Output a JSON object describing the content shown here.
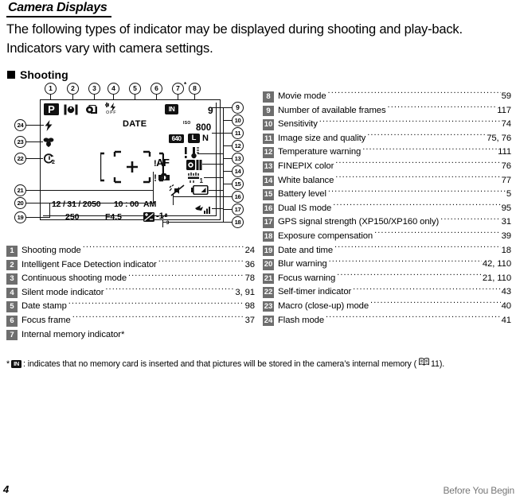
{
  "header": {
    "section_title": "Camera Displays",
    "intro": "The following types of indicator may be displayed during shooting and play-back.  Indicators vary with camera settings.",
    "subsection": "Shooting"
  },
  "figure": {
    "alt": "camera LCD shooting display diagram",
    "lcd": {
      "shooting_mode": "P",
      "face_detection": "face-detection-icon",
      "continuous": "continuous-shooting-icon",
      "silent_mode": "silent-mode-icon",
      "silent_off_label": "OFF",
      "date_stamp": "DATE",
      "internal_memory": "IN",
      "frames_remaining": "9",
      "iso_label": "ISO",
      "iso_value": "800",
      "movie_mode": "640",
      "image_size": "L",
      "image_quality": "N",
      "temperature_warning": "temperature-warning-icon",
      "finepix_color": "finepix-color-icon",
      "white_balance": "white-balance-icon",
      "battery": "battery-icon",
      "dual_is": "dual-is-icon",
      "focus_warning": "AF",
      "blur_warning": "blur-warning-icon",
      "gps": "gps-signal-icon",
      "date": "12 / 31 / 2050",
      "time": "10 : 00",
      "ampm": "AM",
      "shutter_speed": "250",
      "aperture": "F4.5",
      "exposure_comp": "-1",
      "exposure_comp_frac_num": "2",
      "exposure_comp_frac_den": "3"
    },
    "callouts_top": [
      "1",
      "2",
      "3",
      "4",
      "5",
      "6",
      "7",
      "8"
    ],
    "callout7_mark": "*",
    "callouts_right": [
      "9",
      "10",
      "11",
      "12",
      "13",
      "14",
      "15",
      "16",
      "17",
      "18"
    ],
    "callouts_left": [
      "24",
      "23",
      "22",
      "21",
      "20",
      "19"
    ]
  },
  "index_left": [
    {
      "num": "1",
      "label": "Shooting mode",
      "page": "24"
    },
    {
      "num": "2",
      "label": "Intelligent Face Detection indicator",
      "page": "36"
    },
    {
      "num": "3",
      "label": "Continuous shooting mode",
      "page": "78"
    },
    {
      "num": "4",
      "label": "Silent mode indicator",
      "page": "3, 91"
    },
    {
      "num": "5",
      "label": "Date stamp",
      "page": "98"
    },
    {
      "num": "6",
      "label": "Focus frame",
      "page": "37"
    },
    {
      "num": "7",
      "label": "Internal memory indicator*",
      "page": ""
    }
  ],
  "index_right": [
    {
      "num": "8",
      "label": "Movie mode",
      "page": "59"
    },
    {
      "num": "9",
      "label": "Number of available frames",
      "page": "117"
    },
    {
      "num": "10",
      "label": "Sensitivity",
      "page": "74"
    },
    {
      "num": "11",
      "label": "Image size and quality",
      "page": "75, 76"
    },
    {
      "num": "12",
      "label": "Temperature warning",
      "page": "111"
    },
    {
      "num": "13",
      "label": "FINEPIX color",
      "page": "76"
    },
    {
      "num": "14",
      "label": "White balance",
      "page": "77"
    },
    {
      "num": "15",
      "label": "Battery level",
      "page": "5"
    },
    {
      "num": "16",
      "label": "Dual IS mode",
      "page": "95"
    },
    {
      "num": "17",
      "label": "GPS signal strength (XP150/XP160 only)",
      "page": "31"
    },
    {
      "num": "18",
      "label": "Exposure compensation",
      "page": "39"
    },
    {
      "num": "19",
      "label": "Date and time",
      "page": "18"
    },
    {
      "num": "20",
      "label": "Blur warning",
      "page": "42, 110"
    },
    {
      "num": "21",
      "label": "Focus warning",
      "page": "21, 110"
    },
    {
      "num": "22",
      "label": "Self-timer indicator",
      "page": "43"
    },
    {
      "num": "23",
      "label": "Macro (close-up) mode",
      "page": "40"
    },
    {
      "num": "24",
      "label": "Flash mode",
      "page": "41"
    }
  ],
  "footnote": {
    "marker": "*",
    "badge": "IN",
    "text_before": ": indicates that no memory card is inserted and that pictures will be stored in the camera’s internal memory (",
    "ref_page": "11",
    "text_after": ")."
  },
  "footer": {
    "page_number": "4",
    "running_head": "Before You Begin"
  },
  "colors": {
    "ink": "#000000",
    "num_badge": "#6e6e6e",
    "runhead": "#777777"
  }
}
